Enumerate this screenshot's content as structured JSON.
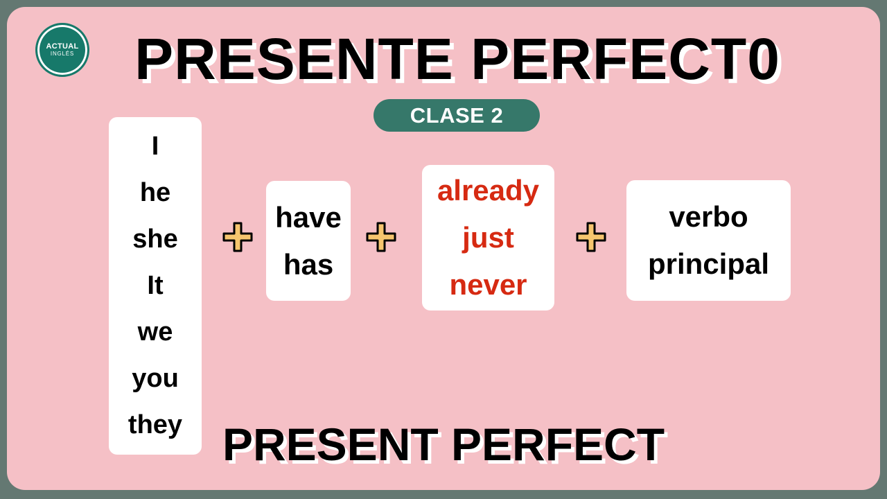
{
  "logo": {
    "line1": "ACTUAL",
    "line2": "INGLÉS"
  },
  "title": "PRESENTE PERFECT0",
  "class_badge": "CLASE 2",
  "pronouns": [
    "I",
    "he",
    "she",
    "It",
    "we",
    "you",
    "they"
  ],
  "auxiliaries": [
    "have",
    "has"
  ],
  "adverbs": [
    "already",
    "just",
    "never"
  ],
  "verb": [
    "verbo",
    "principal"
  ],
  "plus_symbol": "plus-icon",
  "bottom_title": "PRESENT PERFECT",
  "colors": {
    "frame": "#647872",
    "background": "#f5c0c6",
    "badge": "#36786a",
    "adverb_text": "#d62a12",
    "plus_fill": "#f6c56e"
  }
}
